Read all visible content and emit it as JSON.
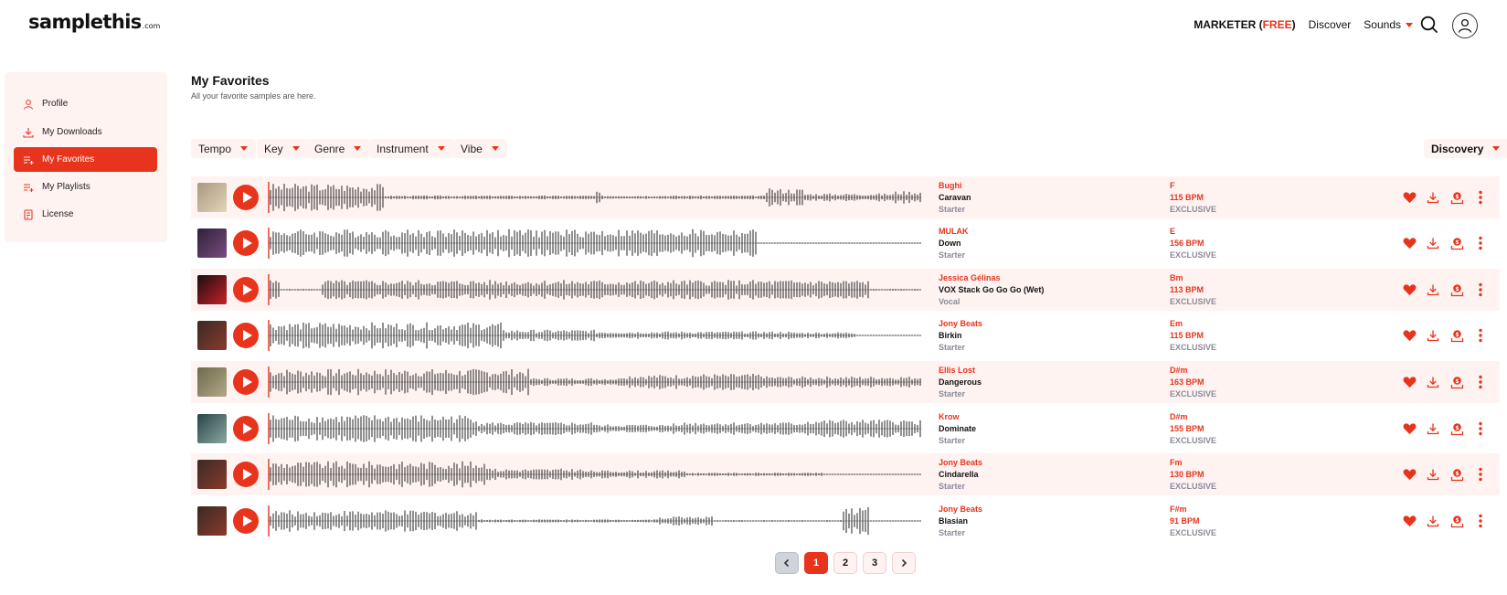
{
  "logo": {
    "main": "samplethis",
    "tld": ".com"
  },
  "nav": {
    "plan_label": "MARKETER (",
    "plan_value": "FREE",
    "plan_close": ")",
    "discover": "Discover",
    "sounds": "Sounds",
    "search_icon": "search-icon",
    "user_icon": "user-icon"
  },
  "sidebar": {
    "items": [
      {
        "label": "Profile",
        "icon": "user-icon",
        "active": false
      },
      {
        "label": "My Downloads",
        "icon": "download-icon",
        "active": false
      },
      {
        "label": "My Favorites",
        "icon": "list-icon",
        "active": true
      },
      {
        "label": "My Playlists",
        "icon": "playlist-add-icon",
        "active": false
      },
      {
        "label": "License",
        "icon": "license-icon",
        "active": false
      }
    ]
  },
  "page": {
    "title": "My Favorites",
    "subtitle": "All your favorite samples are here."
  },
  "filters": [
    "Tempo",
    "Key",
    "Genre",
    "Instrument",
    "Vibe"
  ],
  "sort": {
    "label": "Discovery"
  },
  "colors": {
    "accent": "#e8341c",
    "row_shade": "#fff3f2",
    "muted": "#8a8a9a"
  },
  "tracks": [
    {
      "artist": "Bughi",
      "title": "Caravan",
      "category": "Starter",
      "key": "F",
      "bpm": "115 BPM",
      "license": "EXCLUSIVE",
      "thumb": [
        "#a89880",
        "#e3d5b8"
      ]
    },
    {
      "artist": "MULAK",
      "title": "Down",
      "category": "Starter",
      "key": "E",
      "bpm": "156 BPM",
      "license": "EXCLUSIVE",
      "thumb": [
        "#2c2238",
        "#7c4a80"
      ]
    },
    {
      "artist": "Jessica Gélinas",
      "title": "VOX Stack Go Go Go (Wet)",
      "category": "Vocal",
      "key": "Bm",
      "bpm": "113 BPM",
      "license": "EXCLUSIVE",
      "thumb": [
        "#1a0e10",
        "#c8202a"
      ]
    },
    {
      "artist": "Jony Beats",
      "title": "Birkin",
      "category": "Starter",
      "key": "Em",
      "bpm": "115 BPM",
      "license": "EXCLUSIVE",
      "thumb": [
        "#3a2a24",
        "#8a3a2c"
      ]
    },
    {
      "artist": "Ellis Lost",
      "title": "Dangerous",
      "category": "Starter",
      "key": "D#m",
      "bpm": "163 BPM",
      "license": "EXCLUSIVE",
      "thumb": [
        "#6c6a4c",
        "#b4a886"
      ]
    },
    {
      "artist": "Krow",
      "title": "Dominate",
      "category": "Starter",
      "key": "D#m",
      "bpm": "155 BPM",
      "license": "EXCLUSIVE",
      "thumb": [
        "#2a4448",
        "#8aa8a0"
      ]
    },
    {
      "artist": "Jony Beats",
      "title": "Cindarella",
      "category": "Starter",
      "key": "Fm",
      "bpm": "130 BPM",
      "license": "EXCLUSIVE",
      "thumb": [
        "#3a2a24",
        "#8a3a2c"
      ]
    },
    {
      "artist": "Jony Beats",
      "title": "Blasian",
      "category": "Starter",
      "key": "F#m",
      "bpm": "91 BPM",
      "license": "EXCLUSIVE",
      "thumb": [
        "#3a2a24",
        "#8a3a2c"
      ]
    }
  ],
  "pagination": {
    "pages": [
      "1",
      "2",
      "3"
    ],
    "current": "1"
  }
}
